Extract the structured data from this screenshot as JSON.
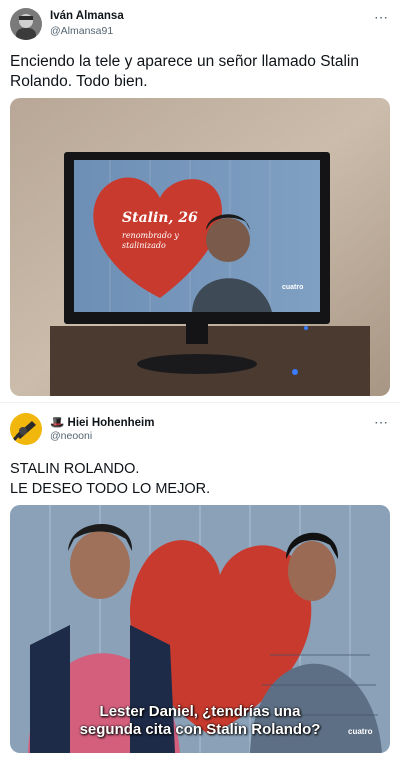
{
  "tweets": [
    {
      "display_name": "Iván Almansa",
      "handle": "@Almansa91",
      "more_icon": "⋯",
      "text_lines": [
        "Enciendo la tele y aparece un señor llamado Stalin",
        "Rolando. Todo bien."
      ],
      "media": {
        "caption_title": "Stalin, 26",
        "caption_sub_1": "renombrado y",
        "caption_sub_2": "stalinizado",
        "channel_logo": "cuatro"
      }
    },
    {
      "display_name": "Hiei Hohenheim",
      "emoji": "🎩",
      "handle": "@neooni",
      "more_icon": "⋯",
      "text_lines": [
        "STALIN ROLANDO.",
        "LE DESEO TODO LO MEJOR."
      ],
      "media": {
        "subtitle_1": "Lester Daniel, ¿tendrías una",
        "subtitle_2": "segunda cita con Stalin Rolando?",
        "channel_logo": "cuatro"
      }
    }
  ],
  "colors": {
    "text_primary": "#0f1419",
    "text_secondary": "#536471",
    "divider": "#eff3f4",
    "heart_red": "#c83a2e",
    "tv_screen_blue": "#5a7fa8",
    "wall": "#c7b9a8"
  }
}
